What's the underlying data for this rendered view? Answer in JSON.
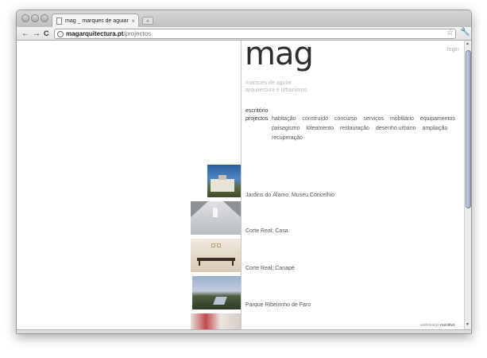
{
  "browser": {
    "tab_title": "mag _ marques de aguiar _ a",
    "tab_close": "×",
    "new_tab": "+",
    "url_domain": "magarquitectura.pt",
    "url_path": "/projectos",
    "icons": [
      "back-arrow-icon",
      "forward-arrow-icon",
      "reload-icon",
      "globe-icon",
      "star-icon",
      "wrench-icon"
    ],
    "back": "←",
    "forward": "→",
    "reload": "C",
    "star": "☆",
    "wrench": "🔧"
  },
  "site": {
    "logo": "mag",
    "tagline_1": "marques de aguiar",
    "tagline_2": "arquitectura e urbanismo",
    "login": "login",
    "nav": {
      "escritorio": "escritório",
      "projectos": "projectos"
    },
    "categories_row1": [
      "habitação",
      "construído",
      "concurso",
      "serviços",
      "mobiliário",
      "equipamentos"
    ],
    "categories_row2": [
      "paisagismo",
      "loteamento",
      "restauração",
      "desenho urbano",
      "ampliação"
    ],
    "categories_row3": [
      "recuperação"
    ],
    "projects": [
      {
        "label": "Jardins do Álamo: Museu Concelhio"
      },
      {
        "label": "Corte Real: Casa"
      },
      {
        "label": "Corte Real: Canapé"
      },
      {
        "label": "Parque Ribeirinho de Faro"
      },
      {
        "label": ""
      }
    ],
    "credit_prefix": "webdesign",
    "credit_name": "nucolivo"
  },
  "colors": {
    "logo": "#2d2d2d",
    "tagline": "#b8b8b8",
    "text": "#555555",
    "divider": "#c9c9c9"
  }
}
